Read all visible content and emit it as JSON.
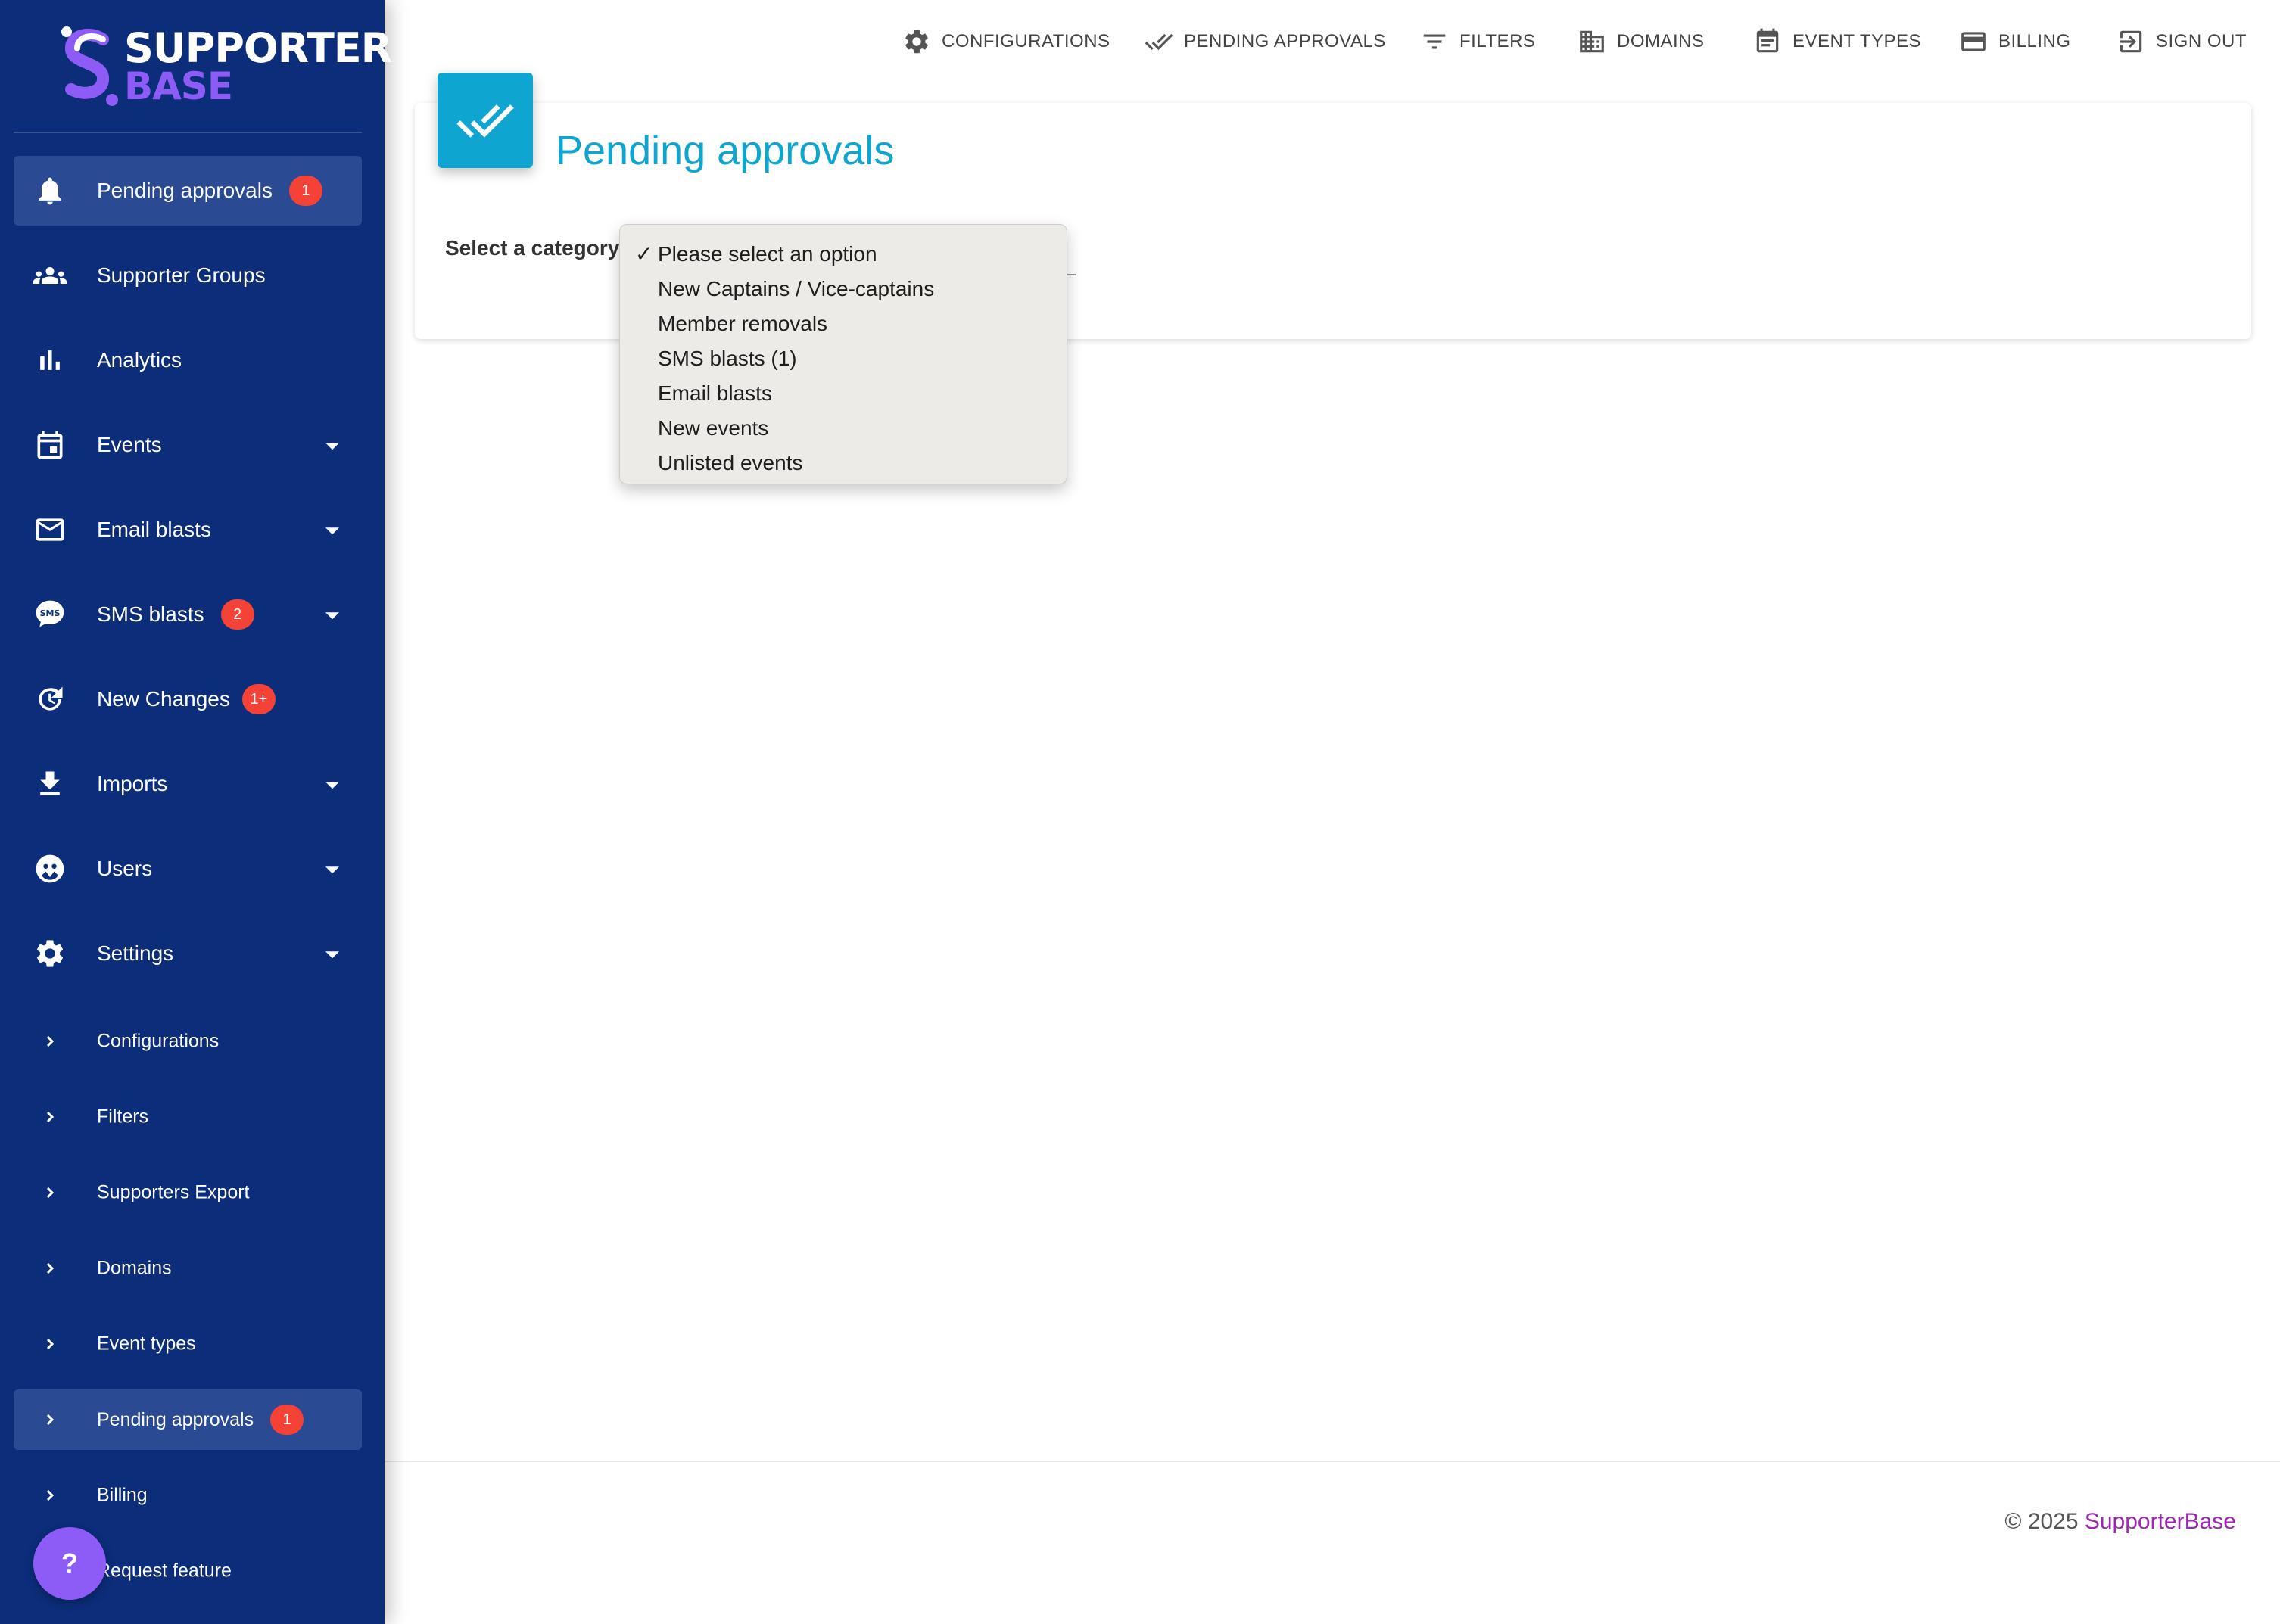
{
  "brand": {
    "logo_line1": "SUPPORTER",
    "logo_line2": "BASE",
    "primary_color": "#0b2d7a",
    "accent_color": "#8d5cf6",
    "title_color": "#0ea5d0",
    "badge_color": "#f44336"
  },
  "sidebar": {
    "items": [
      {
        "label": "Pending approvals",
        "icon": "bell-icon",
        "badge": "1",
        "active": true
      },
      {
        "label": "Supporter Groups",
        "icon": "group-icon"
      },
      {
        "label": "Analytics",
        "icon": "bar-chart-icon"
      },
      {
        "label": "Events",
        "icon": "calendar-icon",
        "expandable": true
      },
      {
        "label": "Email blasts",
        "icon": "mail-icon",
        "expandable": true
      },
      {
        "label": "SMS blasts",
        "icon": "sms-icon",
        "badge": "2",
        "expandable": true
      },
      {
        "label": "New Changes",
        "icon": "refresh-icon",
        "badge": "1+"
      },
      {
        "label": "Imports",
        "icon": "download-icon",
        "expandable": true
      },
      {
        "label": "Users",
        "icon": "user-face-icon",
        "expandable": true
      },
      {
        "label": "Settings",
        "icon": "gear-icon",
        "expandable": true
      }
    ],
    "sub_items": [
      {
        "label": "Configurations"
      },
      {
        "label": "Filters"
      },
      {
        "label": "Supporters Export"
      },
      {
        "label": "Domains"
      },
      {
        "label": "Event types"
      },
      {
        "label": "Pending approvals",
        "badge": "1",
        "active": true
      },
      {
        "label": "Billing"
      },
      {
        "label": "Request feature"
      }
    ],
    "help_label": "?"
  },
  "topnav": {
    "items": [
      {
        "label": "CONFIGURATIONS",
        "icon": "gear-icon"
      },
      {
        "label": "PENDING APPROVALS",
        "icon": "double-check-icon"
      },
      {
        "label": "FILTERS",
        "icon": "filter-icon"
      },
      {
        "label": "DOMAINS",
        "icon": "building-icon"
      },
      {
        "label": "EVENT TYPES",
        "icon": "event-note-icon"
      },
      {
        "label": "BILLING",
        "icon": "credit-card-icon"
      },
      {
        "label": "SIGN OUT",
        "icon": "exit-icon"
      }
    ]
  },
  "main": {
    "title": "Pending approvals",
    "select_label": "Select a category:",
    "dropdown": {
      "selected": "Please select an option",
      "check_mark": "✓",
      "options": [
        "Please select an option",
        "New Captains / Vice-captains",
        "Member removals",
        "SMS blasts (1)",
        "Email blasts",
        "New events",
        "Unlisted events"
      ]
    }
  },
  "footer": {
    "copyright": "© 2025",
    "link_text": "SupporterBase"
  }
}
